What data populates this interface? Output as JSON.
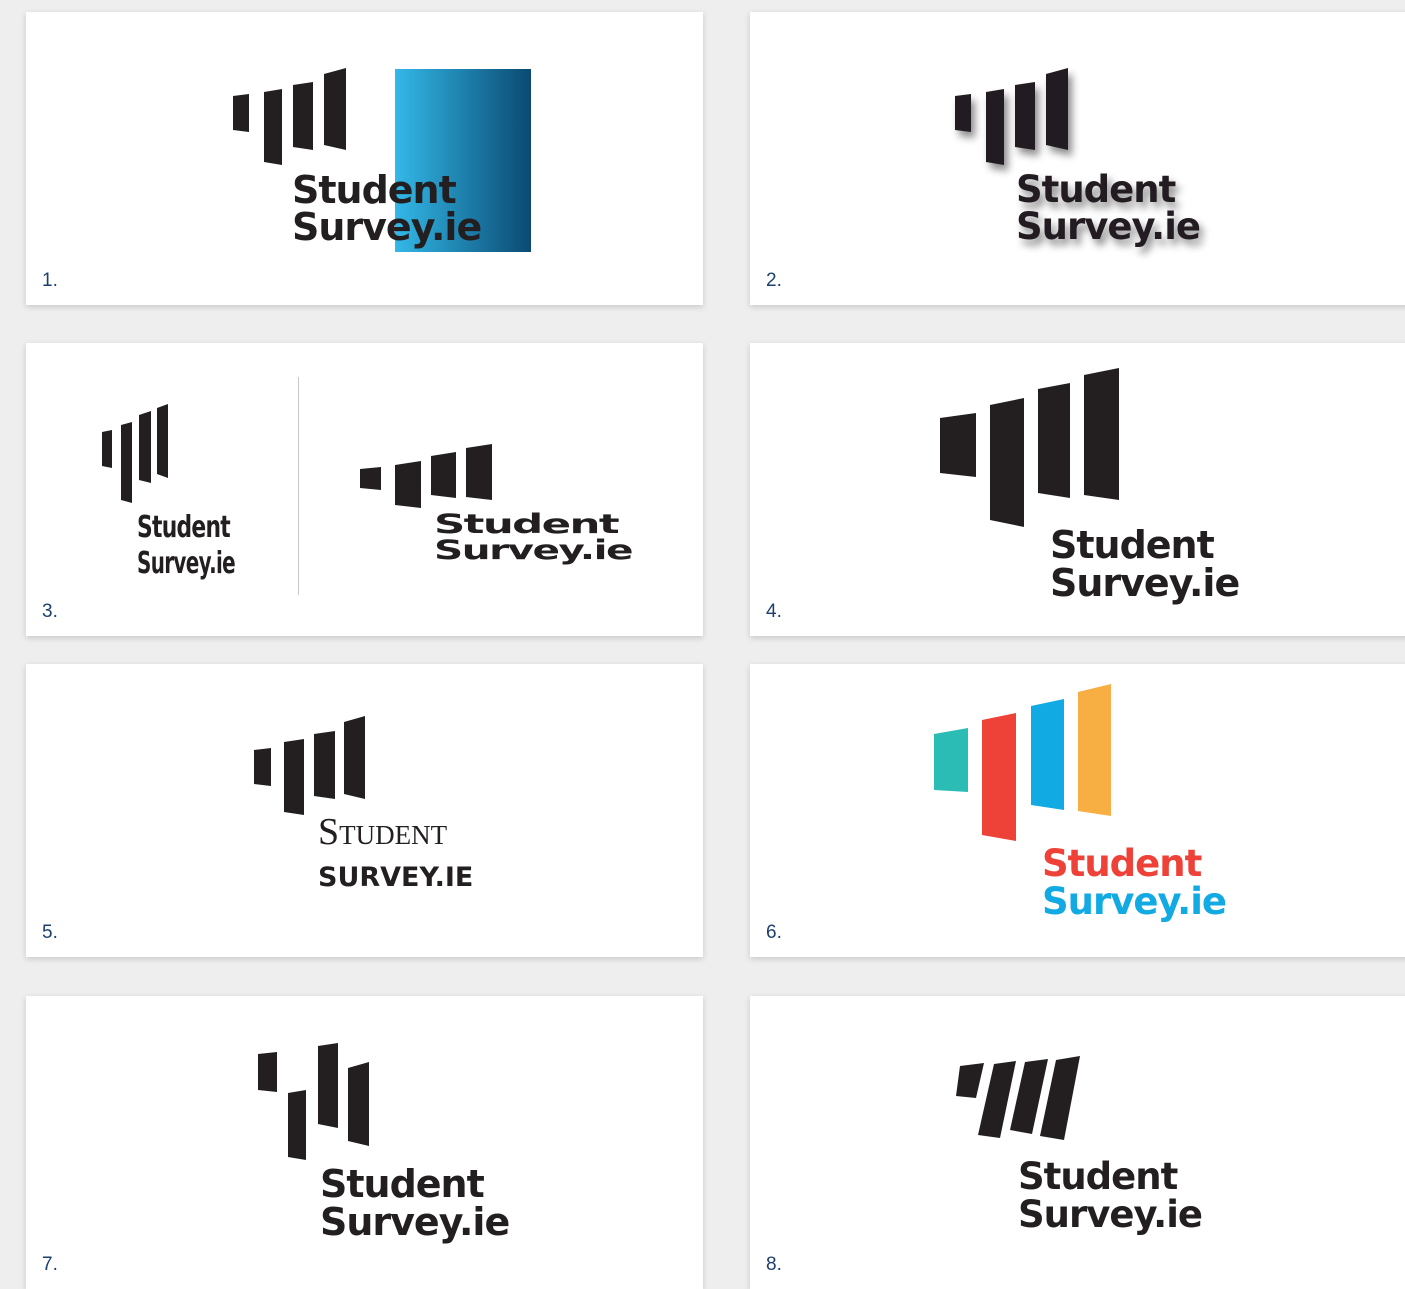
{
  "logo": {
    "line1": "Student",
    "line2": "Survey.ie"
  },
  "logo_serif": {
    "line1": "Student",
    "line2": "SURVEY.IE"
  },
  "cards": [
    {
      "number": "1.",
      "variant": "gradient-square"
    },
    {
      "number": "2.",
      "variant": "drop-shadow"
    },
    {
      "number": "3.",
      "variant": "condensed-and-extended"
    },
    {
      "number": "4.",
      "variant": "large-bars"
    },
    {
      "number": "5.",
      "variant": "serif-wordmark"
    },
    {
      "number": "6.",
      "variant": "multicolour"
    },
    {
      "number": "7.",
      "variant": "staggered-bars"
    },
    {
      "number": "8.",
      "variant": "slanted-bars"
    }
  ],
  "colors": {
    "page_background": "#eeeeef",
    "card_background": "#ffffff",
    "logo_black": "#231f20",
    "number_blue": "#1c3f6e",
    "gradient_start": "#33b8e8",
    "gradient_end": "#0a4a72",
    "bar_teal": "#2bbdb5",
    "bar_red": "#ee4137",
    "bar_blue": "#12aae3",
    "bar_orange": "#f7ae43",
    "wordmark_red": "#ee4137",
    "wordmark_blue": "#12aae3"
  }
}
